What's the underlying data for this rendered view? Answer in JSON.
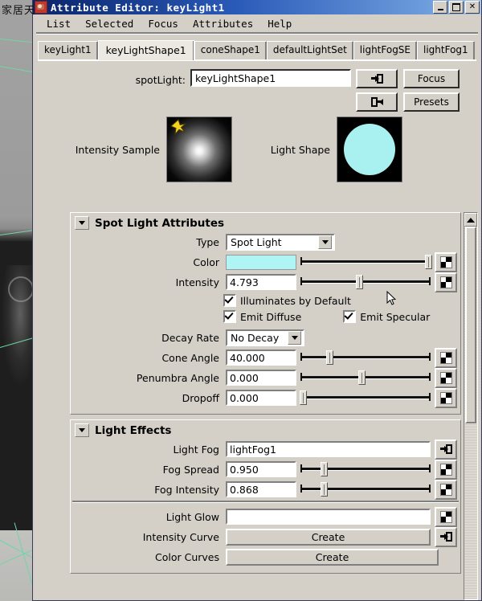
{
  "background": {
    "watermark": "家居天",
    "viewport_name": "maya-viewport"
  },
  "window": {
    "title": "Attribute Editor: keyLight1",
    "icon": "maya-app-icon",
    "buttons": {
      "minimize": "minimize-icon",
      "maximize": "maximize-icon",
      "close": "close-icon"
    }
  },
  "menu": {
    "items": [
      {
        "label": "List"
      },
      {
        "label": "Selected"
      },
      {
        "label": "Focus"
      },
      {
        "label": "Attributes"
      },
      {
        "label": "Help"
      }
    ]
  },
  "tabs": [
    {
      "label": "keyLight1",
      "active": false
    },
    {
      "label": "keyLightShape1",
      "active": true
    },
    {
      "label": "coneShape1",
      "active": false
    },
    {
      "label": "defaultLightSet",
      "active": false
    },
    {
      "label": "lightFogSE",
      "active": false
    },
    {
      "label": "lightFog1",
      "active": false
    }
  ],
  "node": {
    "type_label": "spotLight:",
    "name_value": "keyLightShape1",
    "load_icon": "arrow-into-box-icon",
    "unload_icon": "arrow-out-of-box-icon",
    "focus_button": "Focus",
    "presets_button": "Presets"
  },
  "samples": {
    "intensity_label": "Intensity Sample",
    "light_shape_label": "Light Shape",
    "light_shape_color": "#a9f1f0",
    "cursor_icon": "star-cursor-icon"
  },
  "spot_light_attributes": {
    "title": "Spot Light Attributes",
    "collapse_icon": "triangle-down-icon",
    "type": {
      "label": "Type",
      "value": "Spot Light"
    },
    "color": {
      "label": "Color",
      "value": "#b0f5f5",
      "slider_pct": 98
    },
    "intensity": {
      "label": "Intensity",
      "value": "4.793",
      "slider_pct": 45
    },
    "checkboxes": [
      {
        "label": "Illuminates by Default",
        "checked": true
      },
      {
        "label": "Emit Diffuse",
        "checked": true
      },
      {
        "label": "Emit Specular",
        "checked": true
      }
    ],
    "decay_rate": {
      "label": "Decay Rate",
      "value": "No Decay"
    },
    "cone_angle": {
      "label": "Cone Angle",
      "value": "40.000",
      "slider_pct": 22
    },
    "penumbra_angle": {
      "label": "Penumbra Angle",
      "value": "0.000",
      "slider_pct": 47
    },
    "dropoff": {
      "label": "Dropoff",
      "value": "0.000",
      "slider_pct": 2
    }
  },
  "light_effects": {
    "title": "Light Effects",
    "collapse_icon": "triangle-down-icon",
    "light_fog": {
      "label": "Light Fog",
      "value": "lightFog1",
      "icon": "arrow-into-box-icon"
    },
    "fog_spread": {
      "label": "Fog Spread",
      "value": "0.950",
      "slider_pct": 18
    },
    "fog_intensity": {
      "label": "Fog Intensity",
      "value": "0.868",
      "slider_pct": 18
    },
    "light_glow": {
      "label": "Light Glow",
      "value": "",
      "icon": "checker-map-icon"
    },
    "intensity_curve": {
      "label": "Intensity Curve",
      "button": "Create",
      "icon": "arrow-into-box-icon"
    },
    "color_curves": {
      "label": "Color Curves",
      "button": "Create"
    }
  },
  "scrollbar": {
    "up_arrow": "scroll-up-icon"
  }
}
